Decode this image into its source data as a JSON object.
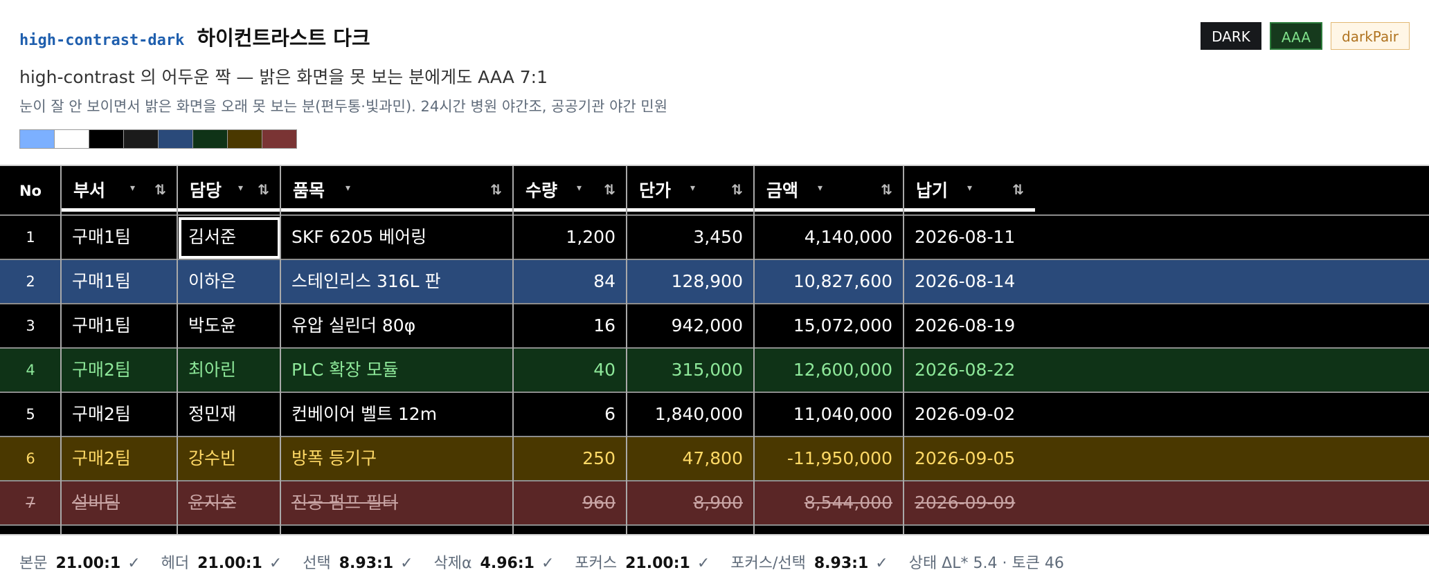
{
  "header": {
    "code_name": "high-contrast-dark",
    "korean_name": "하이컨트라스트 다크",
    "subtitle": "high-contrast 의 어두운 짝 — 밝은 화면을 못 보는 분에게도 AAA 7:1",
    "description": "눈이 잘 안 보이면서 밝은 화면을 오래 못 보는 분(편두통·빛과민). 24시간 병원 야간조, 공공기관 야간 민원",
    "badges": [
      "DARK",
      "AAA",
      "darkPair"
    ],
    "swatches": [
      "#7cb0ff",
      "#ffffff",
      "#000000",
      "#1b1b1b",
      "#2a4a7a",
      "#0f3317",
      "#4a3800",
      "#7a3434"
    ]
  },
  "table": {
    "columns": [
      {
        "key": "no",
        "label": "No"
      },
      {
        "key": "dept",
        "label": "부서"
      },
      {
        "key": "owner",
        "label": "담당"
      },
      {
        "key": "item",
        "label": "품목"
      },
      {
        "key": "qty",
        "label": "수량"
      },
      {
        "key": "price",
        "label": "단가"
      },
      {
        "key": "amount",
        "label": "금액"
      },
      {
        "key": "due",
        "label": "납기"
      }
    ],
    "dropdown_glyph": "▾",
    "sort_glyph": "⇅",
    "rows": [
      {
        "no": "1",
        "dept": "구매1팀",
        "owner": "김서준",
        "item": "SKF 6205 베어링",
        "qty": "1,200",
        "price": "3,450",
        "amount": "4,140,000",
        "due": "2026-08-11",
        "state": "focus"
      },
      {
        "no": "2",
        "dept": "구매1팀",
        "owner": "이하은",
        "item": "스테인리스 316L 판",
        "qty": "84",
        "price": "128,900",
        "amount": "10,827,600",
        "due": "2026-08-14",
        "state": "selected"
      },
      {
        "no": "3",
        "dept": "구매1팀",
        "owner": "박도윤",
        "item": "유압 실린더 80φ",
        "qty": "16",
        "price": "942,000",
        "amount": "15,072,000",
        "due": "2026-08-19",
        "state": "normal"
      },
      {
        "no": "4",
        "dept": "구매2팀",
        "owner": "최아린",
        "item": "PLC 확장 모듈",
        "qty": "40",
        "price": "315,000",
        "amount": "12,600,000",
        "due": "2026-08-22",
        "state": "success"
      },
      {
        "no": "5",
        "dept": "구매2팀",
        "owner": "정민재",
        "item": "컨베이어 벨트 12m",
        "qty": "6",
        "price": "1,840,000",
        "amount": "11,040,000",
        "due": "2026-09-02",
        "state": "normal"
      },
      {
        "no": "6",
        "dept": "구매2팀",
        "owner": "강수빈",
        "item": "방폭 등기구",
        "qty": "250",
        "price": "47,800",
        "amount": "-11,950,000",
        "due": "2026-09-05",
        "state": "warning"
      },
      {
        "no": "7",
        "dept": "설비팀",
        "owner": "윤지호",
        "item": "진공 펌프 필터",
        "qty": "960",
        "price": "8,900",
        "amount": "8,544,000",
        "due": "2026-09-09",
        "state": "deleted"
      }
    ]
  },
  "colors": {
    "normal_bg": "#000000",
    "normal_fg": "#ffffff",
    "selected_bg": "#2a4a7a",
    "selected_fg": "#ffffff",
    "success_bg": "#0f3317",
    "success_fg": "#8ee89a",
    "warning_bg": "#4a3800",
    "warning_fg": "#ffd966",
    "deleted_bg": "#5a2626",
    "deleted_fg": "#c9a5a5"
  },
  "footer": {
    "items": [
      {
        "label": "본문",
        "value": "21.00:1",
        "mark": "✓"
      },
      {
        "label": "헤더",
        "value": "21.00:1",
        "mark": "✓"
      },
      {
        "label": "선택",
        "value": "8.93:1",
        "mark": "✓"
      },
      {
        "label": "삭제α",
        "value": "4.96:1",
        "mark": "✓"
      },
      {
        "label": "포커스",
        "value": "21.00:1",
        "mark": "✓"
      },
      {
        "label": "포커스/선택",
        "value": "8.93:1",
        "mark": "✓"
      }
    ],
    "status": "상태 ΔL* 5.4 · 토큰 46"
  }
}
